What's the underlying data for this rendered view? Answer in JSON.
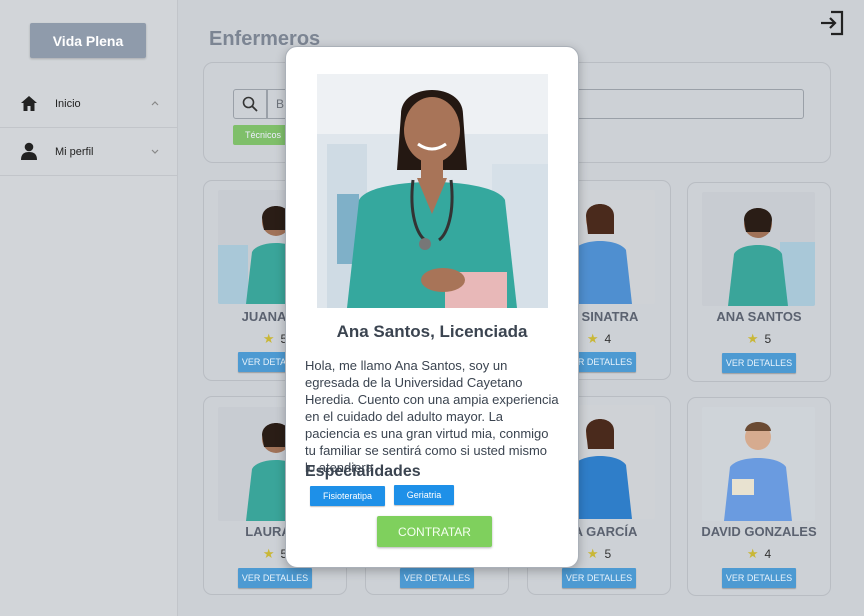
{
  "colors": {
    "brand_button": "#8f9bab",
    "accent_green": "#7fd05d",
    "accent_blue": "#1e90e8",
    "card_button_blue": "#4d9ad2",
    "overlay_bg": "#ccd0d5"
  },
  "sidebar": {
    "brand": "Vida Plena",
    "items": [
      {
        "label": "Inicio",
        "icon": "home-icon"
      },
      {
        "label": "Mi perfil",
        "icon": "user-icon"
      }
    ]
  },
  "header": {
    "title": "Enfermeros",
    "logout_icon": "logout-icon"
  },
  "filters": {
    "search_placeholder": "B",
    "chip": "Técnicos"
  },
  "cards": [
    {
      "name": "JUANA CA",
      "rating": "5",
      "button": "VER DETALLES"
    },
    {
      "name": "NA SINATRA",
      "rating": "4",
      "button": "VER DETALLES"
    },
    {
      "name": "ANA SANTOS",
      "rating": "5",
      "button": "VER DETALLES"
    },
    {
      "name": "LAURA M",
      "rating": "5",
      "button": "VER DETALLES"
    },
    {
      "name": "",
      "rating": "",
      "button": "VER DETALLES"
    },
    {
      "name": "DIA GARCÍA",
      "rating": "5",
      "button": "VER DETALLES"
    },
    {
      "name": "DAVID GONZALES",
      "rating": "4",
      "button": "VER DETALLES"
    }
  ],
  "modal": {
    "name": "Ana Santos, Licenciada",
    "bio": "Hola, me llamo Ana Santos, soy un egresada de la Universidad Cayetano Heredia. Cuento con una ampia experiencia en el cuidado del adulto mayor. La paciencia es una gran virtud mia, conmigo tu familiar se sentirá como si usted mismo lo atendiera",
    "specialties_title": "Especialidades",
    "specialties": [
      "Fisioteratipa",
      "Geriatria"
    ],
    "cta": "CONTRATAR"
  }
}
